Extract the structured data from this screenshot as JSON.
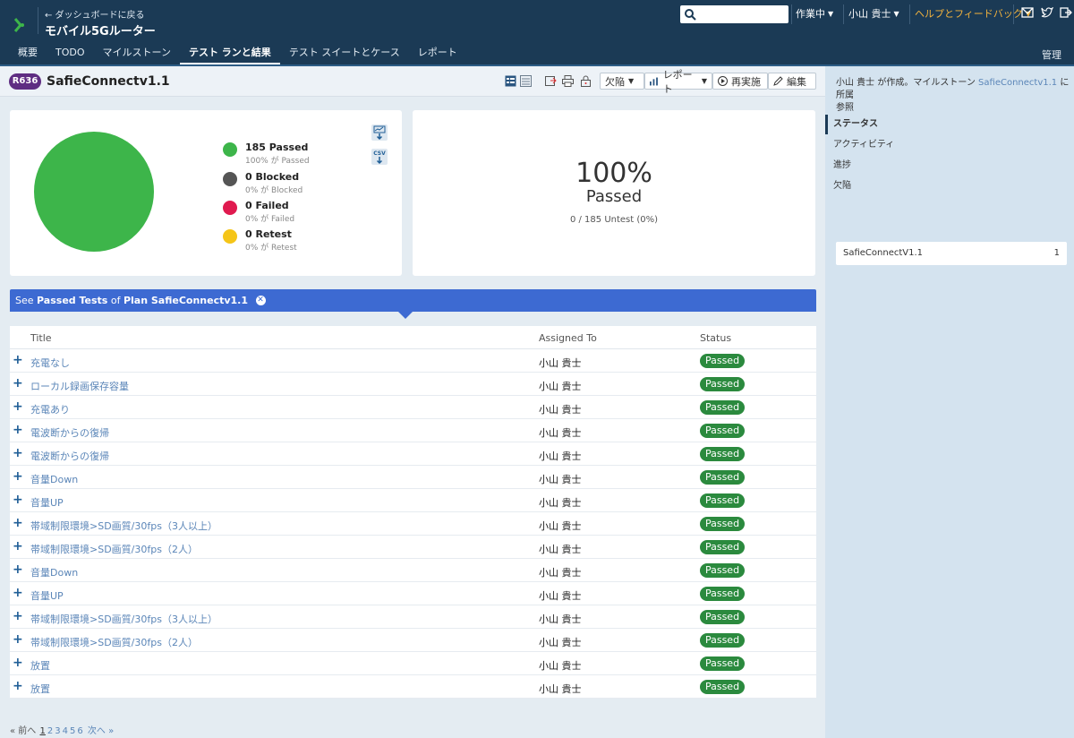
{
  "header": {
    "back_link": "← ダッシュボードに戻る",
    "project_title": "モバイル5Gルーター",
    "search_placeholder": "",
    "menu_working": "作業中",
    "menu_user": "小山 貴士",
    "menu_help": "ヘルプとフィードバック",
    "icons": [
      "mail-icon",
      "twitter-icon",
      "logout-icon"
    ]
  },
  "nav": {
    "items": [
      "概要",
      "TODO",
      "マイルストーン",
      "テスト ランと結果",
      "テスト スイートとケース",
      "レポート"
    ],
    "active_index": 3,
    "admin": "管理"
  },
  "run": {
    "badge": "R636",
    "title": "SafieConnectv1.1",
    "btn_defects": "欠陥",
    "btn_report": "レポート",
    "btn_rerun": "再実施",
    "btn_edit": "編集"
  },
  "chart_data": {
    "type": "pie",
    "categories": [
      "Passed",
      "Blocked",
      "Failed",
      "Retest"
    ],
    "values": [
      185,
      0,
      0,
      0
    ],
    "colors": [
      "#3db54a",
      "#555555",
      "#e01a4f",
      "#f5c518"
    ]
  },
  "legend": [
    {
      "label": "185 Passed",
      "sub": "100% が Passed"
    },
    {
      "label": "0 Blocked",
      "sub": "0% が Blocked"
    },
    {
      "label": "0 Failed",
      "sub": "0% が Failed"
    },
    {
      "label": "0 Retest",
      "sub": "0% が Retest"
    }
  ],
  "summary": {
    "percent": "100%",
    "label": "Passed",
    "untested": "0 / 185 Untest (0%)"
  },
  "filter": {
    "see": "See",
    "passed_tests": "Passed Tests",
    "of": "of",
    "plan": "Plan SafieConnectv1.1"
  },
  "table": {
    "columns": [
      "Title",
      "Assigned To",
      "Status"
    ],
    "rows": [
      {
        "title": "充電なし",
        "assignee": "小山 貴士",
        "status": "Passed"
      },
      {
        "title": "ローカル録画保存容量",
        "assignee": "小山 貴士",
        "status": "Passed"
      },
      {
        "title": "充電あり",
        "assignee": "小山 貴士",
        "status": "Passed"
      },
      {
        "title": "電波断からの復帰",
        "assignee": "小山 貴士",
        "status": "Passed"
      },
      {
        "title": "電波断からの復帰",
        "assignee": "小山 貴士",
        "status": "Passed"
      },
      {
        "title": "音量Down",
        "assignee": "小山 貴士",
        "status": "Passed"
      },
      {
        "title": "音量UP",
        "assignee": "小山 貴士",
        "status": "Passed"
      },
      {
        "title": "帯域制限環境>SD画質/30fps（3人以上）",
        "assignee": "小山 貴士",
        "status": "Passed"
      },
      {
        "title": "帯域制限環境>SD画質/30fps（2人）",
        "assignee": "小山 貴士",
        "status": "Passed"
      },
      {
        "title": "音量Down",
        "assignee": "小山 貴士",
        "status": "Passed"
      },
      {
        "title": "音量UP",
        "assignee": "小山 貴士",
        "status": "Passed"
      },
      {
        "title": "帯域制限環境>SD画質/30fps（3人以上）",
        "assignee": "小山 貴士",
        "status": "Passed"
      },
      {
        "title": "帯域制限環境>SD画質/30fps（2人）",
        "assignee": "小山 貴士",
        "status": "Passed"
      },
      {
        "title": "放置",
        "assignee": "小山 貴士",
        "status": "Passed"
      },
      {
        "title": "放置",
        "assignee": "小山 貴士",
        "status": "Passed"
      }
    ]
  },
  "pager": {
    "prev": "« 前へ",
    "pages": [
      "1",
      "2",
      "3",
      "4",
      "5",
      "6"
    ],
    "current": "1",
    "next": "次へ »"
  },
  "sidebar": {
    "desc_pre": "小山 貴士 が作成。マイルストーン",
    "desc_link": "SafieConnectv1.1",
    "desc_post": "に所属",
    "desc_line2": "参照",
    "tabs": [
      "ステータス",
      "アクティビティ",
      "進捗",
      "欠陥"
    ],
    "milestone": {
      "name": "SafieConnectV1.1",
      "count": "1"
    }
  }
}
